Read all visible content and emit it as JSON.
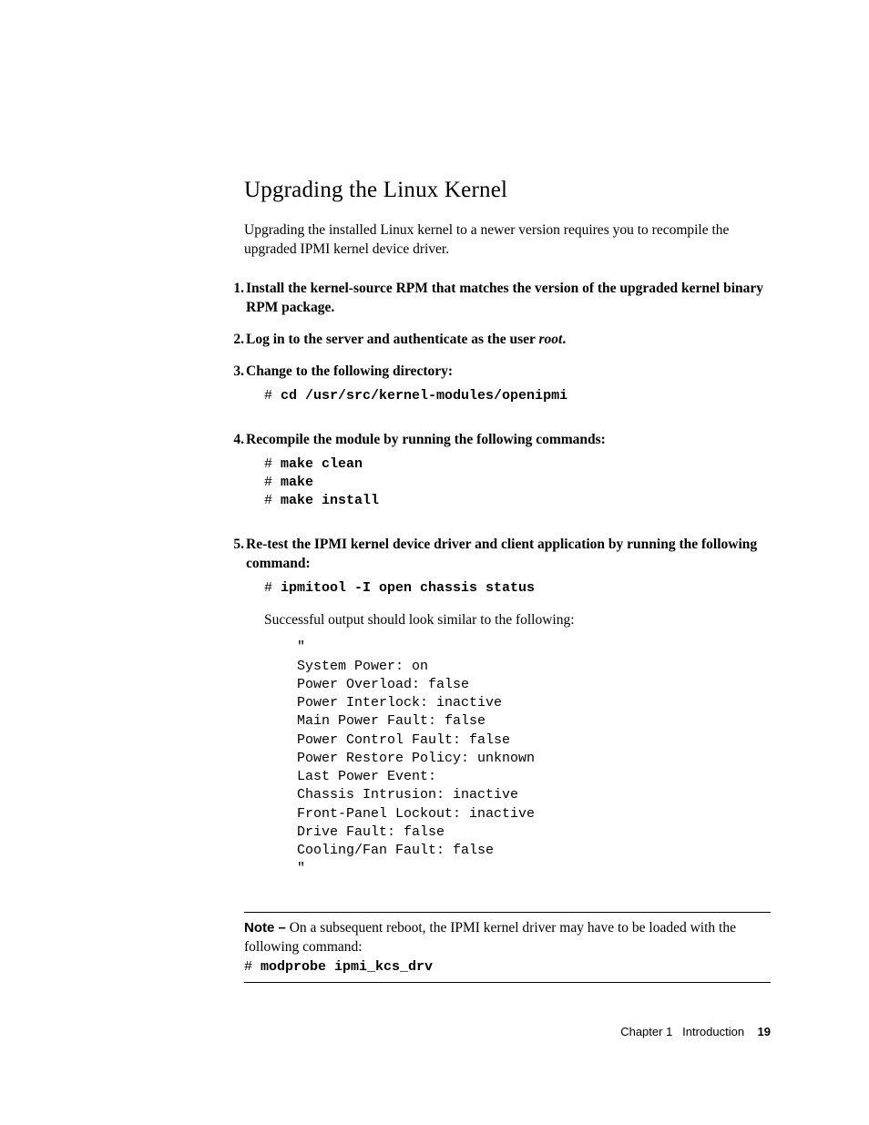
{
  "section": {
    "title": "Upgrading the Linux Kernel",
    "intro": "Upgrading the installed Linux kernel to a newer version requires you to recompile the upgraded IPMI kernel device driver."
  },
  "steps": {
    "s1": {
      "num": "1.",
      "text": "Install the kernel-source RPM that matches the version of the upgraded kernel binary RPM package."
    },
    "s2": {
      "num": "2.",
      "text_prefix": "Log in to the server and authenticate as the user ",
      "user": "root",
      "text_suffix": "."
    },
    "s3": {
      "num": "3.",
      "text": "Change to the following directory:",
      "cmd_prompt": "# ",
      "cmd": "cd /usr/src/kernel-modules/openipmi"
    },
    "s4": {
      "num": "4.",
      "text": "Recompile the module by running the following commands:",
      "cmds": {
        "c1_prompt": "# ",
        "c1": "make clean",
        "c2_prompt": "# ",
        "c2": "make",
        "c3_prompt": "# ",
        "c3": "make install"
      }
    },
    "s5": {
      "num": "5.",
      "text": "Re-test the IPMI kernel device driver and client application by running the following command:",
      "cmd_prompt": "# ",
      "cmd": "ipmitool -I open chassis status",
      "follow": "Successful output should look similar to the following:",
      "output": "\"\nSystem Power: on\nPower Overload: false\nPower Interlock: inactive\nMain Power Fault: false\nPower Control Fault: false\nPower Restore Policy: unknown\nLast Power Event:\nChassis Intrusion: inactive\nFront-Panel Lockout: inactive\nDrive Fault: false\nCooling/Fan Fault: false\n\""
    }
  },
  "note": {
    "label": "Note –",
    "text": " On a subsequent reboot, the IPMI kernel driver may have to be loaded with the following command:",
    "cmd_prompt": "# ",
    "cmd": "modprobe ipmi_kcs_drv"
  },
  "footer": {
    "chapter": "Chapter 1",
    "title": "Introduction",
    "page": "19"
  }
}
